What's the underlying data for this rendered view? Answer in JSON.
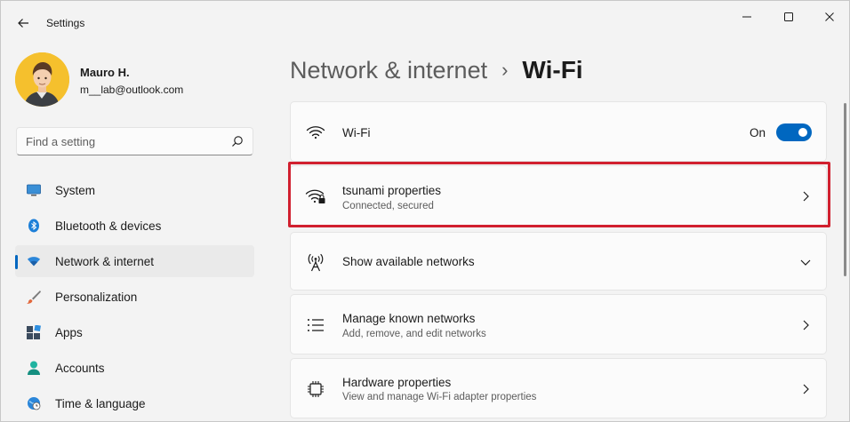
{
  "app": {
    "title": "Settings"
  },
  "window_controls": [
    "minimize",
    "maximize",
    "close"
  ],
  "user": {
    "name": "Mauro H.",
    "email": "m__lab@outlook.com"
  },
  "search": {
    "placeholder": "Find a setting"
  },
  "nav": {
    "items": [
      {
        "label": "System",
        "icon": "system-icon",
        "active": false
      },
      {
        "label": "Bluetooth & devices",
        "icon": "bluetooth-icon",
        "active": false
      },
      {
        "label": "Network & internet",
        "icon": "wifi-icon",
        "active": true
      },
      {
        "label": "Personalization",
        "icon": "brush-icon",
        "active": false
      },
      {
        "label": "Apps",
        "icon": "apps-icon",
        "active": false
      },
      {
        "label": "Accounts",
        "icon": "accounts-icon",
        "active": false
      },
      {
        "label": "Time & language",
        "icon": "globe-icon",
        "active": false
      }
    ]
  },
  "breadcrumb": {
    "parent": "Network & internet",
    "separator": "›",
    "current": "Wi-Fi"
  },
  "cards": {
    "wifi": {
      "title": "Wi-Fi",
      "toggle_label": "On",
      "toggle_on": true
    },
    "network": {
      "title": "tsunami properties",
      "subtitle": "Connected, secured"
    },
    "available": {
      "title": "Show available networks"
    },
    "known": {
      "title": "Manage known networks",
      "subtitle": "Add, remove, and edit networks"
    },
    "hardware": {
      "title": "Hardware properties",
      "subtitle": "View and manage Wi-Fi adapter properties"
    }
  },
  "colors": {
    "accent": "#0067c0",
    "highlight": "#d1202f",
    "background": "#f3f3f3",
    "card": "#fbfbfb"
  }
}
